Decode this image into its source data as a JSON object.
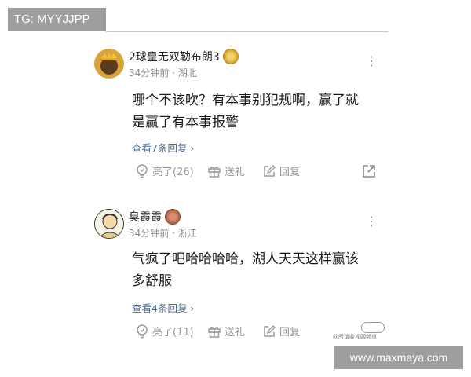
{
  "watermark_tag": "TG: MYYJJPP",
  "comments": [
    {
      "username": "2球皇无双勒布朗3",
      "meta": "34分钟前 · 湖北",
      "line1": "哪个不该吹？有本事别犯规啊，赢了就",
      "line2": "是赢了有本事报警",
      "replies": "查看7条回复 ›",
      "likes": "亮了(26)",
      "gift": "送礼",
      "reply": "回复"
    },
    {
      "username": "臭霞霞",
      "meta": "34分钟前 · 浙江",
      "line1": "气疯了吧哈哈哈哈，湖人天天这样赢该",
      "line2": "多舒服",
      "replies": "查看4条回复 ›",
      "likes": "亮了(11)",
      "gift": "送礼",
      "reply": "回复"
    }
  ],
  "site_watermark": "www.maxmaya.com",
  "source_mark": "@所谓收视四频道",
  "colors": {
    "link": "#4f6a8a",
    "meta": "#8a8a8a",
    "watermark_bg": "#9e9e9e"
  },
  "icons": [
    "more-vertical-icon",
    "like-bulb-icon",
    "gift-icon",
    "reply-edit-icon",
    "share-icon"
  ]
}
